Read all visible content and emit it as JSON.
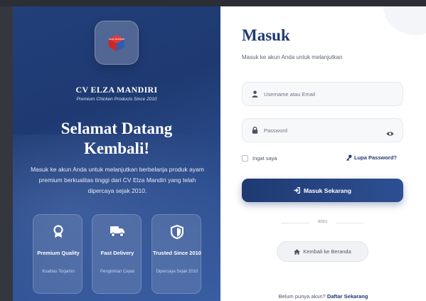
{
  "brand": {
    "company_name": "CV ELZA MANDIRI",
    "tagline": "Premium Chicken Products Since 2010",
    "logo_icon": "cube-logo-icon",
    "logo_text": "ELZA MANDIRI"
  },
  "welcome": {
    "heading": "Selamat Datang Kembali!",
    "description": "Masuk ke akun Anda untuk melanjutkan berbelanja produk ayam premium berkualitas tinggi dari CV Elza Mandiri yang telah dipercaya sejak 2010."
  },
  "features": [
    {
      "icon": "award-icon",
      "title": "Premium Quality",
      "subtitle": "Kualitas Terjamin"
    },
    {
      "icon": "truck-icon",
      "title": "Fast Delivery",
      "subtitle": "Pengiriman Cepat"
    },
    {
      "icon": "shield-icon",
      "title": "Trusted Since 2010",
      "subtitle": "Dipercaya Sejak 2010"
    }
  ],
  "login": {
    "title": "Masuk",
    "subtitle": "Masuk ke akun Anda untuk melanjutkan",
    "username_placeholder": "Username atau Email",
    "password_placeholder": "Password",
    "remember_label": "Ingat saya",
    "forgot_label": "Lupa Password?",
    "submit_label": "Masuk Sekarang",
    "divider_label": "atau",
    "home_label": "Kembali ke Beranda",
    "signup_prompt": "Belum punya akun?",
    "signup_link": "Daftar Sekarang"
  },
  "colors": {
    "primary": "#1f3a72",
    "panel_gradient_end": "#3a5ea3",
    "background": "#ffffff"
  }
}
